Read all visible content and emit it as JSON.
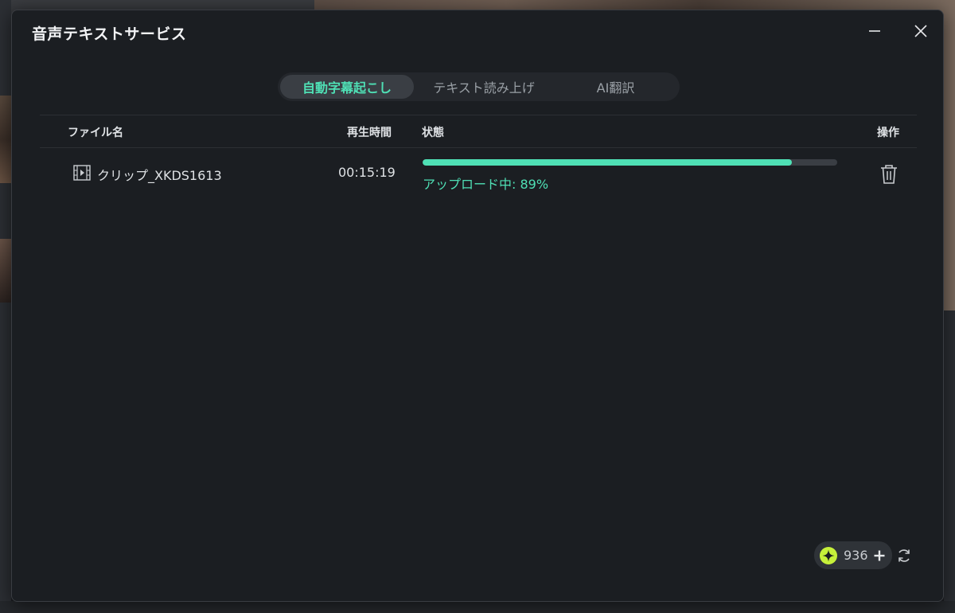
{
  "dialog": {
    "title": "音声テキストサービス"
  },
  "tabs": [
    {
      "label": "自動字幕起こし",
      "active": true
    },
    {
      "label": "テキスト読み上げ",
      "active": false
    },
    {
      "label": "AI翻訳",
      "active": false
    }
  ],
  "table": {
    "headers": {
      "name": "ファイル名",
      "duration": "再生時間",
      "status": "状態",
      "actions": "操作"
    },
    "rows": [
      {
        "file_name": "クリップ_XKDS1613",
        "duration": "00:15:19",
        "status_text": "アップロード中:  89%",
        "progress": 0.89,
        "file_icon": "film-icon",
        "action_icon": "trash-icon"
      }
    ]
  },
  "credits": {
    "count": "936",
    "icon": "sparkle-credit-icon"
  },
  "colors": {
    "accent": "#4fe0b5",
    "credit_icon": "#c6f03a",
    "dialog_bg": "#1b1e22"
  },
  "icons": {
    "minimize": "minimize-icon",
    "close": "close-icon",
    "refresh": "refresh-icon",
    "add": "plus-icon"
  }
}
